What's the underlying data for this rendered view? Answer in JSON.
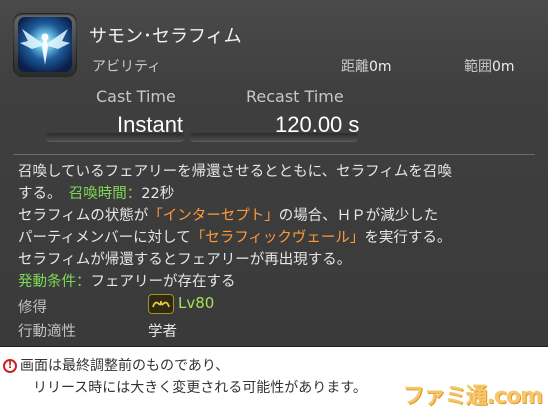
{
  "ability": {
    "name": "サモン･セラフィム",
    "type": "アビリティ",
    "distance_label": "距離",
    "distance_value": "0m",
    "range_label": "範囲",
    "range_value": "0m",
    "icon": "seraph-icon"
  },
  "timing": {
    "cast_label": "Cast Time",
    "cast_value": "Instant",
    "recast_label": "Recast Time",
    "recast_value": "120.00 s"
  },
  "description": {
    "line1": "召喚しているフェアリーを帰還させるとともに、セラフィムを召喚",
    "line2_pre": "する。　",
    "duration_label": "召喚時間：",
    "duration_value": "22秒",
    "line3_pre": "セラフィムの状態が",
    "intercept": "「インターセプト」",
    "line3_post": "の場合、ＨＰが減少した",
    "line4_pre": "パーティメンバーに対して",
    "veil": "「セラフィックヴェール」",
    "line4_post": "を実行する。",
    "line5": "セラフィムが帰還するとフェアリーが再出現する。",
    "condition_label": "発動条件：",
    "condition_value": "フェアリーが存在する"
  },
  "meta": {
    "learn_label": "修得",
    "learn_level": "Lv80",
    "job_icon": "scholar-job-icon",
    "job_label": "行動適性",
    "job_value": "学者"
  },
  "notice": {
    "line1": "画面は最終調整前のものであり、",
    "line2": "リリース時には大きく変更される可能性があります。",
    "warn_glyph": "!"
  },
  "watermark": "ファミ通.com"
}
